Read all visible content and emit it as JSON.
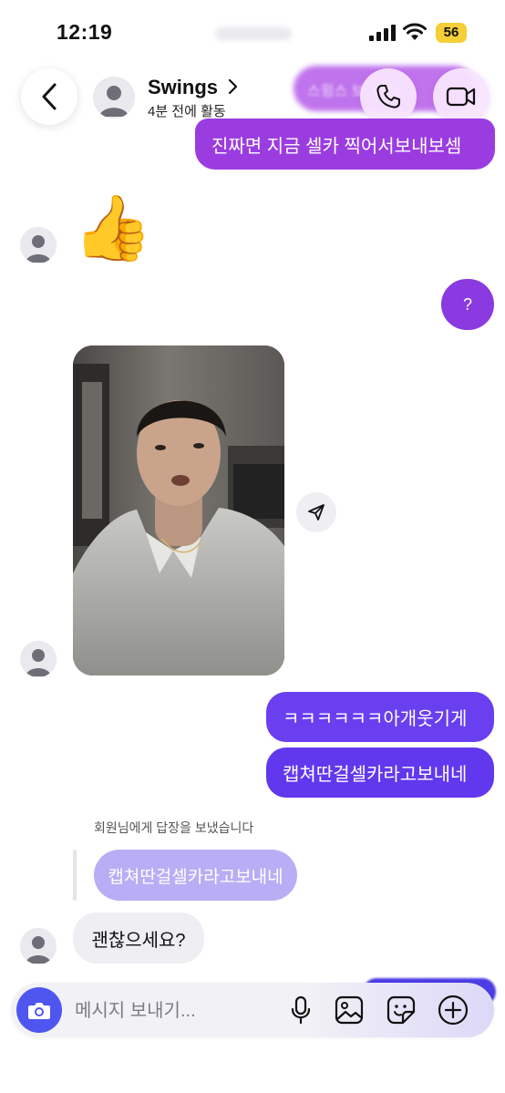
{
  "status_bar": {
    "time": "12:19",
    "battery": "56"
  },
  "header": {
    "contact_name": "Swings",
    "contact_status": "4분 전에 활동",
    "top_preview": "스윙스 보고싶다"
  },
  "messages": {
    "out_1": "진짜면 지금 셀카 찍어서보내보셈",
    "thumb_emoji": "👍",
    "out_2": "?",
    "out_3": "ㅋㅋㅋㅋㅋㅋ아개웃기게",
    "out_4": "캡쳐딴걸셀카라고보내네",
    "reply_note": "회원님에게 답장을 보냈습니다",
    "reply_quote": "캡쳐딴걸셀카라고보내네",
    "in_1": "괜찮으세요?"
  },
  "composer": {
    "placeholder": "메시지 보내기..."
  },
  "colors": {
    "out_purple": "#9b3ce0",
    "out_violet": "#6a3ff0",
    "reply_bubble": "#b9adf5",
    "incoming": "#efeff3",
    "camera_button": "#4f56f0"
  },
  "icons": [
    "back-chevron-icon",
    "call-icon",
    "video-camera-icon",
    "send-icon",
    "camera-icon",
    "microphone-icon",
    "gallery-icon",
    "sticker-icon",
    "plus-icon"
  ]
}
